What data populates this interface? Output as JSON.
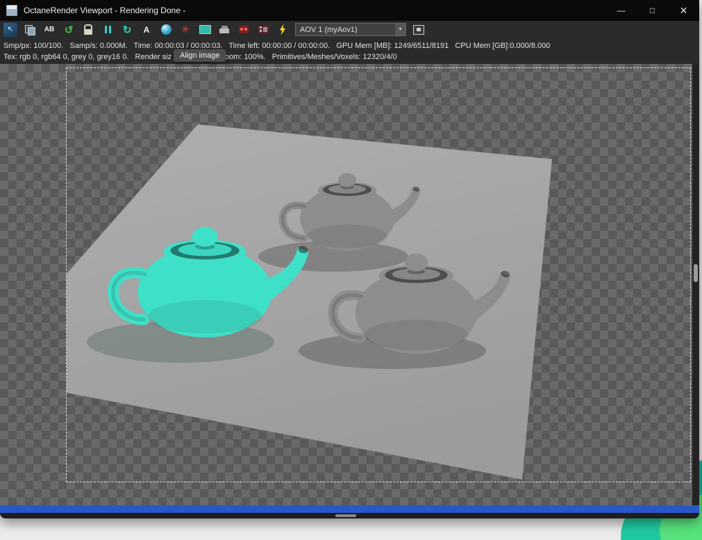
{
  "window": {
    "title": "OctaneRender Viewport - Rendering Done -",
    "controls": {
      "minimize": "—",
      "maximize": "□",
      "close": "×"
    }
  },
  "toolbar": {
    "aov": {
      "value": "AOV 1 (myAov1)",
      "arrow": "▼"
    },
    "icons": {
      "recenter": {
        "glyph": "↖"
      },
      "ab_compare": {
        "label": "AB"
      },
      "refresh": {
        "glyph": "↺"
      },
      "restart": {
        "glyph": "↻"
      },
      "autofocus": {
        "label": "A"
      },
      "starburst": {
        "glyph": "✳"
      }
    }
  },
  "status": {
    "line1": "Smp/px: 100/100.   Samp/s: 0.000M.   Time: 00:00:03 / 00:00:03.   Time left: 00:00:00 / 00:00:00.   GPU Mem [MB]: 1249/6511/8191   CPU Mem [GB]:0.000/8.000",
    "line2_left": "Tex: rgb 0, rgb64 0, grey 0, grey16 0.   Render siz",
    "line2_right": "Zoom: 100%.   Primitives/Meshes/Voxels: 12320/4/0",
    "tooltip": "Align image"
  },
  "viewport": {
    "colors": {
      "checker_light": "#6a6a6a",
      "checker_dark": "#595959",
      "plane_light": "#aeaeae",
      "plane_dark": "#9c9c9c",
      "teapot_teal": "#3fe0c8",
      "teapot_gray": "#8d8d8d",
      "shadow": "#5e6e68",
      "progress_blue": "#2a57c8"
    }
  }
}
